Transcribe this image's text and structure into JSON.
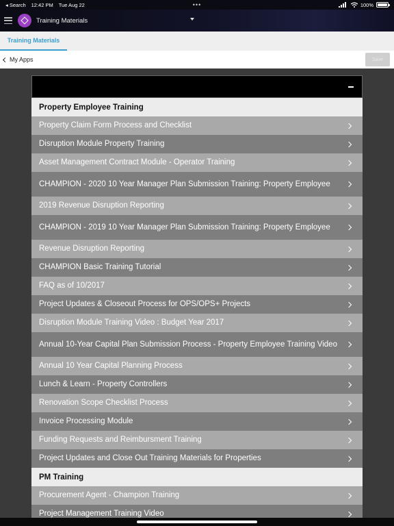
{
  "status_bar": {
    "back_label": "◂ Search",
    "time": "12:42 PM",
    "date": "Tue Aug 22",
    "dots": "•••",
    "battery": "100%"
  },
  "app_bar": {
    "title": "Training Materials"
  },
  "tabs": [
    {
      "label": "Training Materials"
    }
  ],
  "nav": {
    "back_label": "My Apps",
    "save_label": "Save"
  },
  "sections": [
    {
      "title": "Property Employee Training",
      "items": [
        "Property Claim Form Process and Checklist",
        "Disruption Module Property Training",
        "Asset Management Contract Module - Operator Training",
        "CHAMPION - 2020 10 Year Manager Plan Submission Training: Property Employee",
        "2019 Revenue Disruption Reporting",
        "CHAMPION - 2019 10 Year Manager Plan Submission Training: Property Employee",
        "Revenue Disruption Reporting",
        "CHAMPION Basic Training Tutorial",
        "FAQ as of 10/2017",
        "Project Updates & Closeout Process for OPS/OPS+ Projects",
        "Disruption Module Training Video : Budget Year 2017",
        "Annual 10-Year Capital Plan Submission Process - Property Employee Training Video",
        "Annual 10 Year Capital Planning Process",
        "Lunch & Learn - Property Controllers",
        "Renovation Scope Checklist Process",
        "Invoice Processing Module",
        "Funding Requests and Reimbursment Training",
        "Project Updates and Close Out Training Materials for Properties"
      ]
    },
    {
      "title": "PM Training",
      "items": [
        "Procurement Agent - Champion Training",
        "Project Management Training Video"
      ]
    }
  ]
}
